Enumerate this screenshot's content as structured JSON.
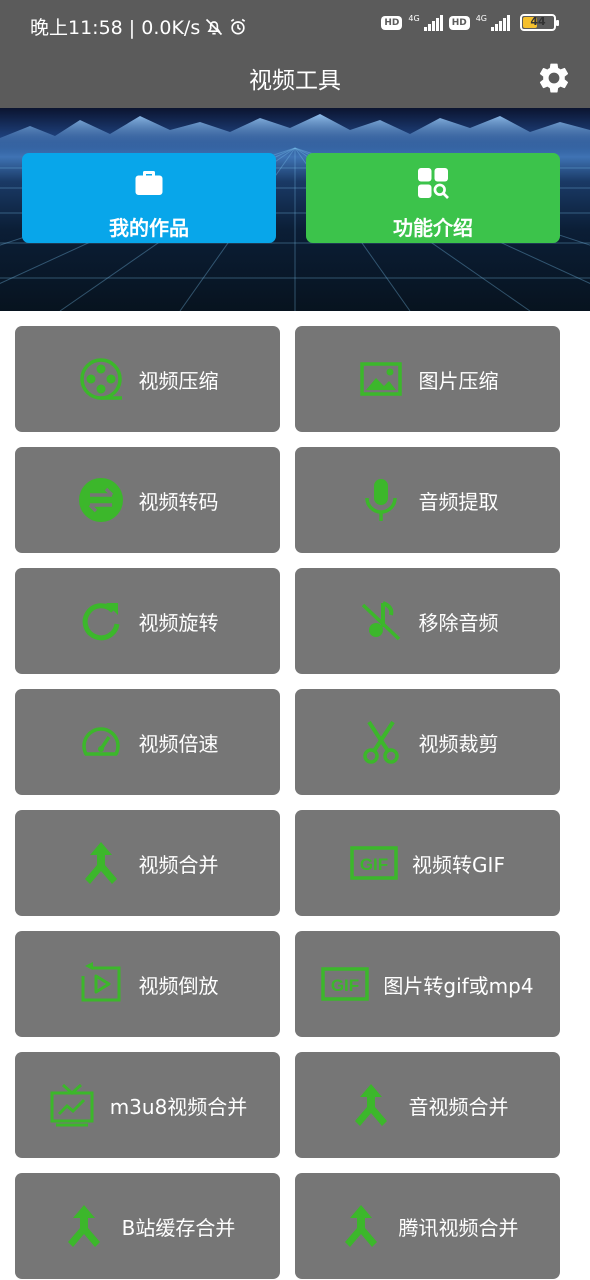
{
  "status_bar": {
    "time": "晚上11:58 | 0.0K/s",
    "hd1": "HD",
    "net1": "4G",
    "hd2": "HD",
    "net2": "4G",
    "battery": "44"
  },
  "header": {
    "title": "视频工具"
  },
  "top_buttons": {
    "works_label": "我的作品",
    "intro_label": "功能介绍"
  },
  "colors": {
    "bar": "#5b5b5b",
    "tile": "#767676",
    "icon_green": "#3cb72b",
    "works_blue": "#08a6ea",
    "intro_green": "#3cc34b"
  },
  "tools": [
    {
      "label": "视频压缩",
      "icon": "film-reel-icon"
    },
    {
      "label": "图片压缩",
      "icon": "image-icon"
    },
    {
      "label": "视频转码",
      "icon": "swap-arrows-icon"
    },
    {
      "label": "音频提取",
      "icon": "microphone-icon"
    },
    {
      "label": "视频旋转",
      "icon": "rotate-icon"
    },
    {
      "label": "移除音频",
      "icon": "music-off-icon"
    },
    {
      "label": "视频倍速",
      "icon": "speedometer-icon"
    },
    {
      "label": "视频裁剪",
      "icon": "scissors-icon"
    },
    {
      "label": "视频合并",
      "icon": "merge-icon"
    },
    {
      "label": "视频转GIF",
      "icon": "gif-icon"
    },
    {
      "label": "视频倒放",
      "icon": "reverse-play-icon"
    },
    {
      "label": "图片转gif或mp4",
      "icon": "gif-icon"
    },
    {
      "label": "m3u8视频合并",
      "icon": "tv-icon"
    },
    {
      "label": "音视频合并",
      "icon": "merge-icon"
    },
    {
      "label": "B站缓存合并",
      "icon": "merge-icon"
    },
    {
      "label": "腾讯视频合并",
      "icon": "merge-icon"
    }
  ]
}
